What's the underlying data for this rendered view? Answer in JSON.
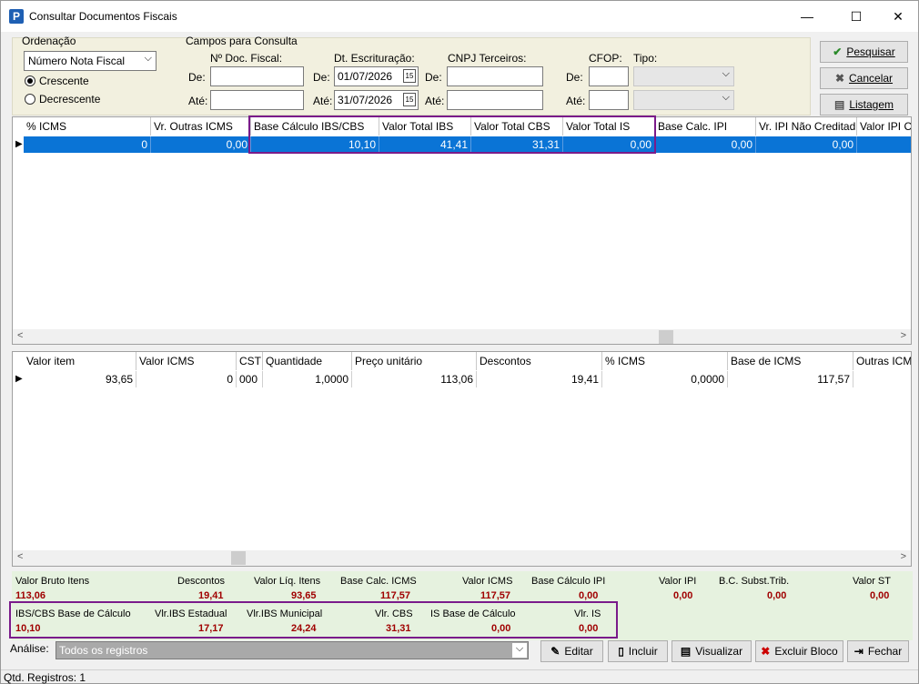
{
  "window": {
    "title": "Consultar Documentos Fiscais",
    "app_icon": "P"
  },
  "ordenacao": {
    "label": "Ordenação",
    "selected": "Número Nota Fiscal",
    "options": [
      "Crescente",
      "Decrescente"
    ],
    "selected_option": "Crescente"
  },
  "campos": {
    "label": "Campos para Consulta",
    "nr_doc_label": "Nº Doc. Fiscal:",
    "dt_label": "Dt. Escrituração:",
    "cnpj_label": "CNPJ Terceiros:",
    "cfop_label": "CFOP:",
    "tipo_label": "Tipo:",
    "de": "De:",
    "ate": "Até:",
    "dt_de": "01/07/2026",
    "dt_ate": "31/07/2026"
  },
  "buttons": {
    "pesquisar": "Pesquisar",
    "cancelar": "Cancelar",
    "listagem": "Listagem"
  },
  "grid1": {
    "headers": [
      "% ICMS",
      "Vr. Outras ICMS",
      "Base Cálculo IBS/CBS",
      "Valor Total IBS",
      "Valor Total CBS",
      "Valor Total IS",
      "Base Calc. IPI",
      "Vr. IPI Não Creditad",
      "Valor IPI C"
    ],
    "row": [
      "0",
      "0,00",
      "10,10",
      "41,41",
      "31,31",
      "0,00",
      "0,00",
      "0,00",
      ""
    ]
  },
  "grid2": {
    "headers": [
      "Valor item",
      "Valor ICMS",
      "CST",
      "Quantidade",
      "Preço unitário",
      "Descontos",
      "% ICMS",
      "Base de ICMS",
      "Outras ICM"
    ],
    "row": [
      "93,65",
      "0",
      "000",
      "1,0000",
      "113,06",
      "19,41",
      "0,0000",
      "117,57",
      ""
    ]
  },
  "totals": {
    "row1_labels": [
      "Valor Bruto Itens",
      "Descontos",
      "Valor Líq. Itens",
      "Base Calc. ICMS",
      "Valor ICMS",
      "Base Cálculo IPI",
      "Valor IPI",
      "B.C. Subst.Trib.",
      "Valor ST"
    ],
    "row1_values": [
      "113,06",
      "19,41",
      "93,65",
      "117,57",
      "117,57",
      "0,00",
      "0,00",
      "0,00",
      "0,00"
    ],
    "row2_labels": [
      "IBS/CBS Base de Cálculo",
      "Vlr.IBS Estadual",
      "Vlr.IBS Municipal",
      "Vlr. CBS",
      "IS Base de Cálculo",
      "Vlr. IS"
    ],
    "row2_values": [
      "10,10",
      "17,17",
      "24,24",
      "31,31",
      "0,00",
      "0,00"
    ]
  },
  "analise": {
    "label": "Análise:",
    "selected": "Todos os registros"
  },
  "actions": {
    "editar": "Editar",
    "incluir": "Incluir",
    "visualizar": "Visualizar",
    "excluir_bloco": "Excluir Bloco",
    "fechar": "Fechar"
  },
  "status": {
    "text": "Qtd. Registros: 1"
  },
  "colors": {
    "selection": "#0a74d6",
    "highlight": "#7a1b8a",
    "total_values": "#a00000",
    "panel": "#f2f0df",
    "totals_bg": "#e6f2df"
  }
}
